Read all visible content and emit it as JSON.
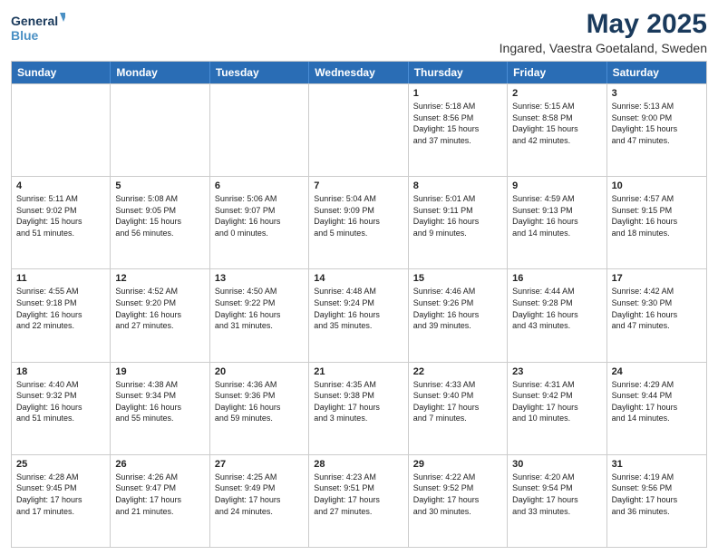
{
  "logo": {
    "line1": "General",
    "line2": "Blue"
  },
  "title": "May 2025",
  "location": "Ingared, Vaestra Goetaland, Sweden",
  "days_of_week": [
    "Sunday",
    "Monday",
    "Tuesday",
    "Wednesday",
    "Thursday",
    "Friday",
    "Saturday"
  ],
  "weeks": [
    [
      {
        "day": "",
        "info": ""
      },
      {
        "day": "",
        "info": ""
      },
      {
        "day": "",
        "info": ""
      },
      {
        "day": "",
        "info": ""
      },
      {
        "day": "1",
        "info": "Sunrise: 5:18 AM\nSunset: 8:56 PM\nDaylight: 15 hours\nand 37 minutes."
      },
      {
        "day": "2",
        "info": "Sunrise: 5:15 AM\nSunset: 8:58 PM\nDaylight: 15 hours\nand 42 minutes."
      },
      {
        "day": "3",
        "info": "Sunrise: 5:13 AM\nSunset: 9:00 PM\nDaylight: 15 hours\nand 47 minutes."
      }
    ],
    [
      {
        "day": "4",
        "info": "Sunrise: 5:11 AM\nSunset: 9:02 PM\nDaylight: 15 hours\nand 51 minutes."
      },
      {
        "day": "5",
        "info": "Sunrise: 5:08 AM\nSunset: 9:05 PM\nDaylight: 15 hours\nand 56 minutes."
      },
      {
        "day": "6",
        "info": "Sunrise: 5:06 AM\nSunset: 9:07 PM\nDaylight: 16 hours\nand 0 minutes."
      },
      {
        "day": "7",
        "info": "Sunrise: 5:04 AM\nSunset: 9:09 PM\nDaylight: 16 hours\nand 5 minutes."
      },
      {
        "day": "8",
        "info": "Sunrise: 5:01 AM\nSunset: 9:11 PM\nDaylight: 16 hours\nand 9 minutes."
      },
      {
        "day": "9",
        "info": "Sunrise: 4:59 AM\nSunset: 9:13 PM\nDaylight: 16 hours\nand 14 minutes."
      },
      {
        "day": "10",
        "info": "Sunrise: 4:57 AM\nSunset: 9:15 PM\nDaylight: 16 hours\nand 18 minutes."
      }
    ],
    [
      {
        "day": "11",
        "info": "Sunrise: 4:55 AM\nSunset: 9:18 PM\nDaylight: 16 hours\nand 22 minutes."
      },
      {
        "day": "12",
        "info": "Sunrise: 4:52 AM\nSunset: 9:20 PM\nDaylight: 16 hours\nand 27 minutes."
      },
      {
        "day": "13",
        "info": "Sunrise: 4:50 AM\nSunset: 9:22 PM\nDaylight: 16 hours\nand 31 minutes."
      },
      {
        "day": "14",
        "info": "Sunrise: 4:48 AM\nSunset: 9:24 PM\nDaylight: 16 hours\nand 35 minutes."
      },
      {
        "day": "15",
        "info": "Sunrise: 4:46 AM\nSunset: 9:26 PM\nDaylight: 16 hours\nand 39 minutes."
      },
      {
        "day": "16",
        "info": "Sunrise: 4:44 AM\nSunset: 9:28 PM\nDaylight: 16 hours\nand 43 minutes."
      },
      {
        "day": "17",
        "info": "Sunrise: 4:42 AM\nSunset: 9:30 PM\nDaylight: 16 hours\nand 47 minutes."
      }
    ],
    [
      {
        "day": "18",
        "info": "Sunrise: 4:40 AM\nSunset: 9:32 PM\nDaylight: 16 hours\nand 51 minutes."
      },
      {
        "day": "19",
        "info": "Sunrise: 4:38 AM\nSunset: 9:34 PM\nDaylight: 16 hours\nand 55 minutes."
      },
      {
        "day": "20",
        "info": "Sunrise: 4:36 AM\nSunset: 9:36 PM\nDaylight: 16 hours\nand 59 minutes."
      },
      {
        "day": "21",
        "info": "Sunrise: 4:35 AM\nSunset: 9:38 PM\nDaylight: 17 hours\nand 3 minutes."
      },
      {
        "day": "22",
        "info": "Sunrise: 4:33 AM\nSunset: 9:40 PM\nDaylight: 17 hours\nand 7 minutes."
      },
      {
        "day": "23",
        "info": "Sunrise: 4:31 AM\nSunset: 9:42 PM\nDaylight: 17 hours\nand 10 minutes."
      },
      {
        "day": "24",
        "info": "Sunrise: 4:29 AM\nSunset: 9:44 PM\nDaylight: 17 hours\nand 14 minutes."
      }
    ],
    [
      {
        "day": "25",
        "info": "Sunrise: 4:28 AM\nSunset: 9:45 PM\nDaylight: 17 hours\nand 17 minutes."
      },
      {
        "day": "26",
        "info": "Sunrise: 4:26 AM\nSunset: 9:47 PM\nDaylight: 17 hours\nand 21 minutes."
      },
      {
        "day": "27",
        "info": "Sunrise: 4:25 AM\nSunset: 9:49 PM\nDaylight: 17 hours\nand 24 minutes."
      },
      {
        "day": "28",
        "info": "Sunrise: 4:23 AM\nSunset: 9:51 PM\nDaylight: 17 hours\nand 27 minutes."
      },
      {
        "day": "29",
        "info": "Sunrise: 4:22 AM\nSunset: 9:52 PM\nDaylight: 17 hours\nand 30 minutes."
      },
      {
        "day": "30",
        "info": "Sunrise: 4:20 AM\nSunset: 9:54 PM\nDaylight: 17 hours\nand 33 minutes."
      },
      {
        "day": "31",
        "info": "Sunrise: 4:19 AM\nSunset: 9:56 PM\nDaylight: 17 hours\nand 36 minutes."
      }
    ]
  ]
}
